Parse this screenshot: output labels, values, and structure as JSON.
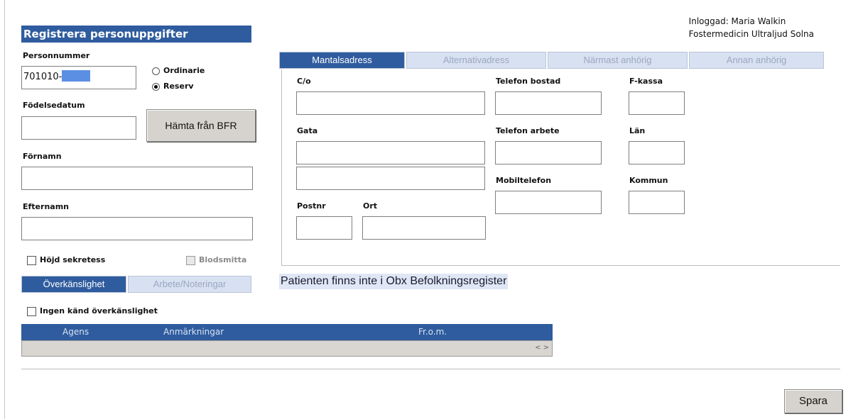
{
  "login": {
    "user_line": "Inloggad: Maria Walkin",
    "unit_line": "Fostermedicin Ultraljud Solna"
  },
  "form": {
    "title": "Registrera personuppgifter",
    "personnummer_label": "Personnummer",
    "personnummer_value": "701010-",
    "radio_ordinarie": "Ordinarie",
    "radio_reserv": "Reserv",
    "fodelsedatum_label": "Födelsedatum",
    "fetch_button": "Hämta från BFR",
    "fornamn_label": "Förnamn",
    "efternamn_label": "Efternamn",
    "hojd_sekretess": "Höjd sekretess",
    "blodsmitta": "Blodsmitta"
  },
  "address_tabs": [
    "Mantalsadress",
    "Alternativadress",
    "Närmast anhörig",
    "Annan anhörig"
  ],
  "address": {
    "co_label": "C/o",
    "gata_label": "Gata",
    "postnr_label": "Postnr",
    "ort_label": "Ort",
    "tel_bostad_label": "Telefon bostad",
    "tel_arbete_label": "Telefon arbete",
    "mobil_label": "Mobiltelefon",
    "fkassa_label": "F-kassa",
    "lan_label": "Län",
    "kommun_label": "Kommun"
  },
  "status_message": "Patienten finns inte i Obx Befolkningsregister",
  "lower_tabs": [
    "Överkänslighet",
    "Arbete/Noteringar"
  ],
  "allergy": {
    "none_checkbox": "Ingen känd överkänslighet",
    "columns": [
      "Agens",
      "Anmärkningar",
      "Fr.o.m."
    ],
    "scroll_glyph": "< >"
  },
  "save_button": "Spara"
}
